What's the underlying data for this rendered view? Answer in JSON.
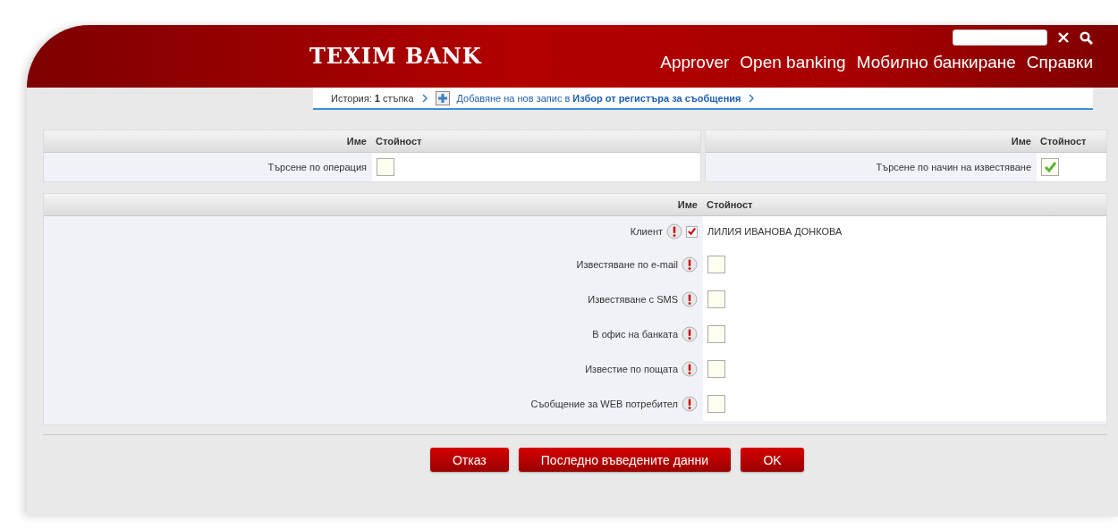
{
  "header": {
    "logo": "TEXIM BANK",
    "nav": [
      "Approver",
      "Open banking",
      "Мобилно банкиране",
      "Справки"
    ]
  },
  "breadcrumb": {
    "history": "История: **1** стъпка",
    "step": "Добавяне на нов запис в **Избор от регистъра за съобщения**"
  },
  "filter_tables": [
    {
      "columns": [
        "Име",
        "Стойност"
      ],
      "rows": [
        {
          "label": "Търсене по операция",
          "checked": false
        }
      ]
    },
    {
      "columns": [
        "Име",
        "Стойност"
      ],
      "rows": [
        {
          "label": "Търсене по начин на известяване",
          "checked": true
        }
      ]
    }
  ],
  "main_table": {
    "columns": [
      "Име",
      "Стойност"
    ],
    "rows": [
      {
        "kind": "text",
        "label": "Клиент",
        "checked": true,
        "value": "ЛИЛИЯ ИВАНОВА ДОНКОВА"
      },
      {
        "kind": "checkbox",
        "label": "Известяване по e-mail",
        "checked": false
      },
      {
        "kind": "checkbox",
        "label": "Известяване с SMS",
        "checked": false
      },
      {
        "kind": "checkbox",
        "label": "В офис на банката",
        "checked": false
      },
      {
        "kind": "checkbox",
        "label": "Известие по пощата",
        "checked": false
      },
      {
        "kind": "checkbox",
        "label": "Съобщение за WEB потребител",
        "checked": false
      }
    ]
  },
  "buttons": [
    "Отказ",
    "Последно въведените данни",
    "OK"
  ]
}
